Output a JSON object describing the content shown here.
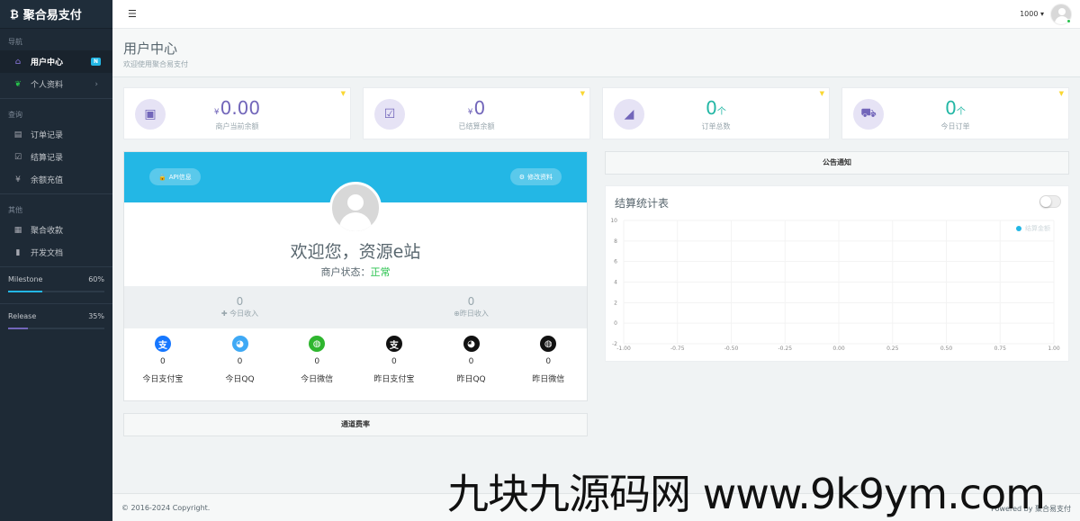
{
  "brand": {
    "name": "聚合易支付",
    "icon": "bitcoin-icon"
  },
  "sidebar": {
    "sections": [
      {
        "title": "导航"
      },
      {
        "title": "查询"
      },
      {
        "title": "其他"
      }
    ],
    "items": [
      {
        "label": "用户中心",
        "badge": "N",
        "icon": "home-icon"
      },
      {
        "label": "个人资料",
        "icon": "leaf-icon"
      },
      {
        "label": "订单记录",
        "icon": "list-icon"
      },
      {
        "label": "结算记录",
        "icon": "check-square-icon"
      },
      {
        "label": "余额充值",
        "icon": "yen-icon"
      },
      {
        "label": "聚合收款",
        "icon": "qrcode-icon"
      },
      {
        "label": "开发文档",
        "icon": "book-icon"
      }
    ],
    "progress": [
      {
        "label": "Milestone",
        "value": "60%",
        "fraction": 0.6,
        "color": "#23b7e5"
      },
      {
        "label": "Release",
        "value": "35%",
        "fraction": 0.35,
        "color": "#7266ba"
      }
    ]
  },
  "header": {
    "username": "1000",
    "menu_icon": "hamburger-icon"
  },
  "page": {
    "title": "用户中心",
    "subtitle": "欢迎使用聚合易支付"
  },
  "stats": [
    {
      "currency": "¥",
      "value": "0.00",
      "unit": "",
      "label": "商户当前余额",
      "icon": "money-icon"
    },
    {
      "currency": "¥",
      "value": "0",
      "unit": "",
      "label": "已结算余额",
      "icon": "check-icon"
    },
    {
      "currency": "",
      "value": "0",
      "unit": "个",
      "label": "订单总数",
      "icon": "area-chart-icon"
    },
    {
      "currency": "",
      "value": "0",
      "unit": "个",
      "label": "今日订单",
      "icon": "cart-icon"
    }
  ],
  "profile": {
    "api_button": "API信息",
    "edit_button": "修改资料",
    "welcome": "欢迎您，资源e站",
    "status_label": "商户状态：",
    "status_value": "正常",
    "income": [
      {
        "value": "0",
        "label": "今日收入",
        "icon": "plus-icon"
      },
      {
        "value": "0",
        "label": "昨日收入",
        "icon": "plus-circle-icon"
      }
    ],
    "channels": [
      {
        "label": "今日支付宝",
        "value": "0",
        "icon": "alipay-icon",
        "color": "#1677ff"
      },
      {
        "label": "今日QQ",
        "value": "0",
        "icon": "qq-icon",
        "color": "#3fa9f5"
      },
      {
        "label": "今日微信",
        "value": "0",
        "icon": "wechat-icon",
        "color": "#2fb62f"
      },
      {
        "label": "昨日支付宝",
        "value": "0",
        "icon": "alipay-icon",
        "color": "#111111"
      },
      {
        "label": "昨日QQ",
        "value": "0",
        "icon": "qq-icon",
        "color": "#111111"
      },
      {
        "label": "昨日微信",
        "value": "0",
        "icon": "wechat-icon",
        "color": "#111111"
      }
    ]
  },
  "rates_bar": "通道费率",
  "notice_bar": "公告通知",
  "chart_title": "结算统计表",
  "chart_data": {
    "type": "line",
    "title": "",
    "series": [
      {
        "name": "结算金额",
        "values": []
      }
    ],
    "x_ticks": [
      "-1.00",
      "-0.75",
      "-0.50",
      "-0.25",
      "0.00",
      "0.25",
      "0.50",
      "0.75",
      "1.00"
    ],
    "y_ticks": [
      "10",
      "8",
      "6",
      "4",
      "2",
      "0",
      "-2"
    ],
    "xlim": [
      -1,
      1
    ],
    "ylim": [
      -2,
      10
    ],
    "legend": "top-right",
    "grid": true,
    "series_color": "#23b7e5"
  },
  "footer": {
    "copyright": "© 2016-2024 Copyright.",
    "powered": "Powered by 聚合易支付"
  },
  "watermark": "九块九源码网 www.9k9ym.com"
}
